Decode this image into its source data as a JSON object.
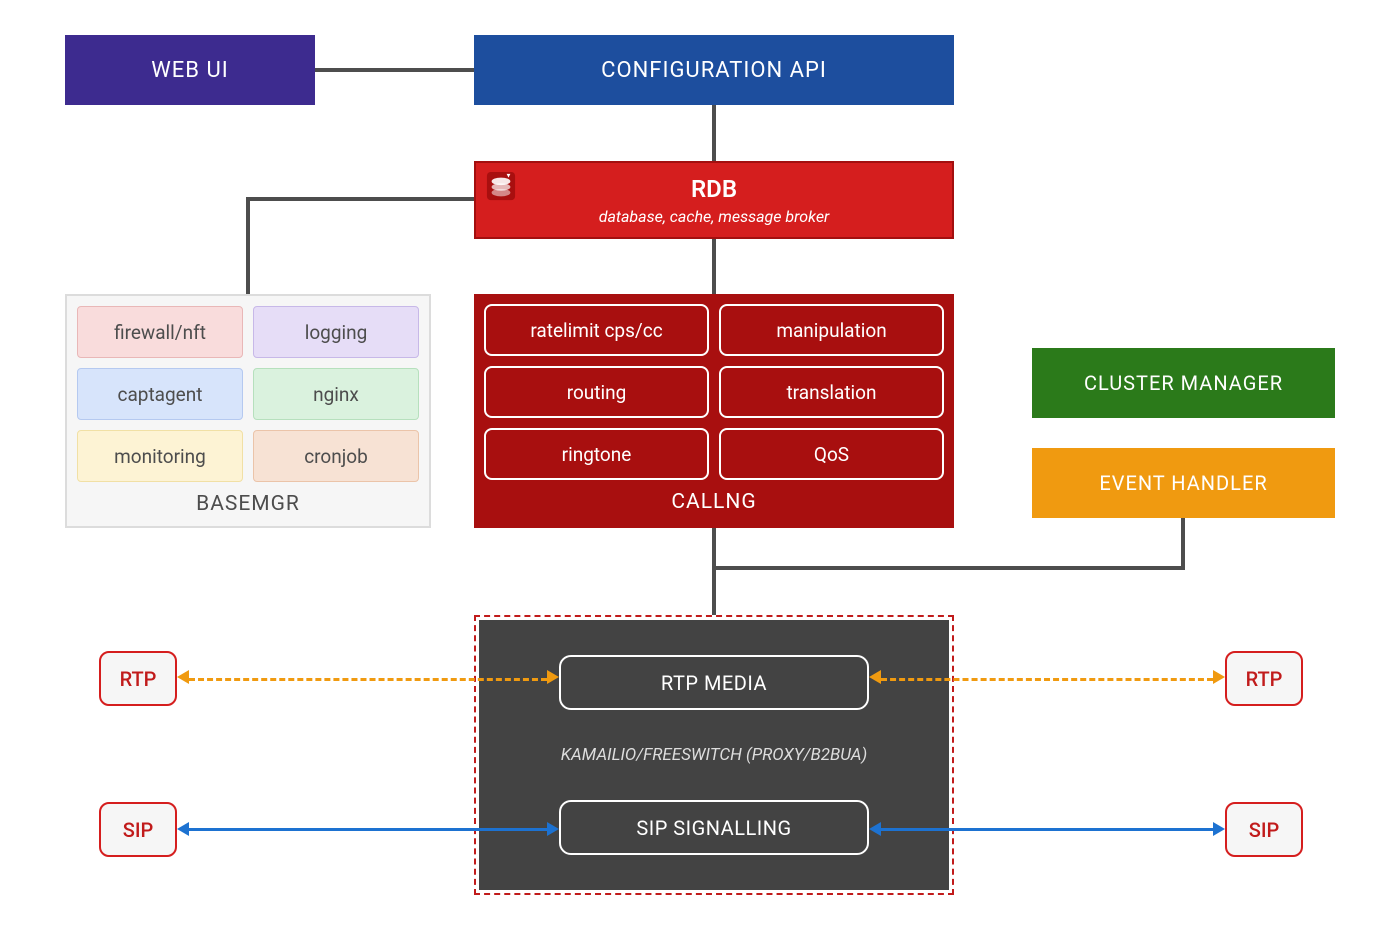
{
  "webui": {
    "label": "WEB UI"
  },
  "configapi": {
    "label": "CONFIGURATION API"
  },
  "rdb": {
    "title": "RDB",
    "subtitle": "database, cache, message broker",
    "icon": "redis-icon"
  },
  "basemgr": {
    "label": "BASEMGR",
    "cells": [
      "firewall/nft",
      "logging",
      "captagent",
      "nginx",
      "monitoring",
      "cronjob"
    ]
  },
  "callng": {
    "label": "CALLNG",
    "cells": [
      "ratelimit cps/cc",
      "manipulation",
      "routing",
      "translation",
      "ringtone",
      "QoS"
    ]
  },
  "cluster": {
    "label": "CLUSTER MANAGER"
  },
  "eventhandler": {
    "label": "EVENT HANDLER"
  },
  "engine": {
    "rtp_label": "RTP MEDIA",
    "sip_label": "SIP SIGNALLING",
    "subtitle": "KAMAILIO/FREESWITCH (PROXY/B2BUA)"
  },
  "endpoints": {
    "rtp": "RTP",
    "sip": "SIP"
  },
  "connectors": {
    "webui_configapi": "solid-gray",
    "configapi_rdb": "solid-gray",
    "rdb_basemgr": "solid-gray",
    "rdb_callng": "solid-gray",
    "callng_engine": "solid-gray",
    "eventhandler_engine": "solid-gray",
    "rtp_lines": "dashed-orange-double-arrow",
    "sip_lines": "solid-blue-double-arrow"
  }
}
